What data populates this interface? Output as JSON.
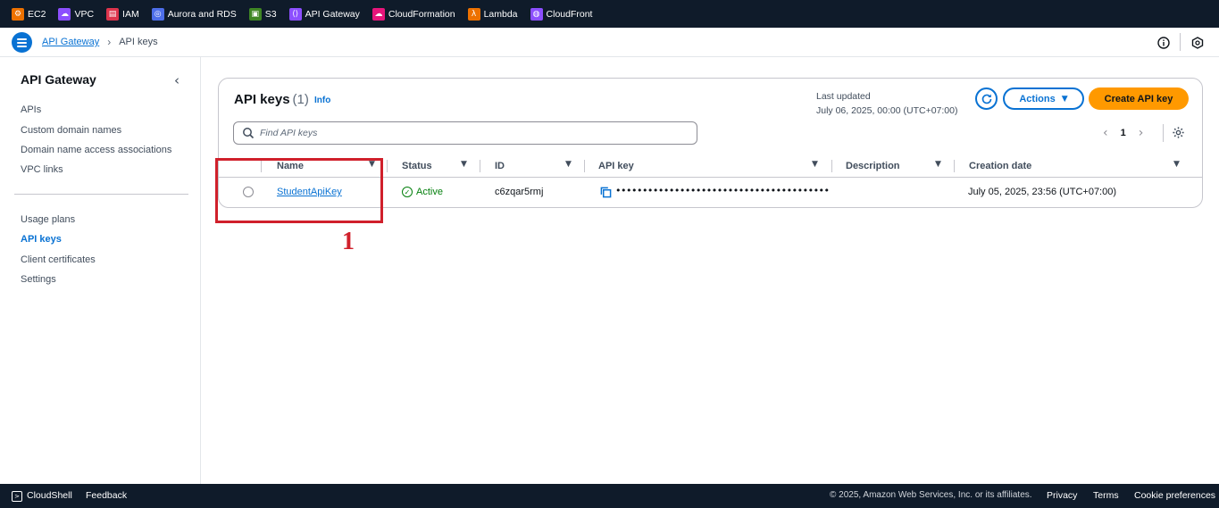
{
  "services": [
    {
      "label": "EC2",
      "icon": "ec2-icon",
      "color": "#ed7100",
      "glyph": "⚙"
    },
    {
      "label": "VPC",
      "icon": "vpc-icon",
      "color": "#8c4fff",
      "glyph": "☁"
    },
    {
      "label": "IAM",
      "icon": "iam-icon",
      "color": "#dd344c",
      "glyph": "▤"
    },
    {
      "label": "Aurora and RDS",
      "icon": "rds-icon",
      "color": "#4d6ee9",
      "glyph": "◎"
    },
    {
      "label": "S3",
      "icon": "s3-icon",
      "color": "#3f8624",
      "glyph": "▣"
    },
    {
      "label": "API Gateway",
      "icon": "api-gateway-icon",
      "color": "#8c4fff",
      "glyph": "⟨⟩"
    },
    {
      "label": "CloudFormation",
      "icon": "cloudformation-icon",
      "color": "#e7157b",
      "glyph": "☁"
    },
    {
      "label": "Lambda",
      "icon": "lambda-icon",
      "color": "#ed7100",
      "glyph": "λ"
    },
    {
      "label": "CloudFront",
      "icon": "cloudfront-icon",
      "color": "#8c4fff",
      "glyph": "◍"
    }
  ],
  "breadcrumb": {
    "parent": "API Gateway",
    "separator": "›",
    "current": "API keys"
  },
  "sidebar": {
    "title": "API Gateway",
    "close_glyph": "‹",
    "items": [
      {
        "label": "APIs"
      },
      {
        "label": "Custom domain names"
      },
      {
        "label": "Domain name access associations"
      },
      {
        "label": "VPC links"
      },
      {
        "label": "Usage plans"
      },
      {
        "label": "API keys",
        "active": true
      },
      {
        "label": "Client certificates"
      },
      {
        "label": "Settings"
      }
    ]
  },
  "panel": {
    "title": "API keys",
    "count": "(1)",
    "info": "Info",
    "last_updated_label": "Last updated",
    "last_updated_value": "July 06, 2025, 00:00 (UTC+07:00)",
    "actions_label": "Actions",
    "create_label": "Create API key",
    "search_placeholder": "Find API keys",
    "page": "1"
  },
  "table": {
    "columns": [
      "Name",
      "Status",
      "ID",
      "API key",
      "Description",
      "Creation date"
    ],
    "rows": [
      {
        "name": "StudentApiKey",
        "status": "Active",
        "id": "c6zqar5rmj",
        "api_key": "••••••••••••••••••••••••••••••••••••••••",
        "description": "",
        "creation_date": "July 05, 2025, 23:56 (UTC+07:00)"
      }
    ]
  },
  "annotation": {
    "label": "1",
    "color": "#d0202b"
  },
  "footer": {
    "cloudshell": "CloudShell",
    "feedback": "Feedback",
    "copyright": "© 2025, Amazon Web Services, Inc. or its affiliates.",
    "privacy": "Privacy",
    "terms": "Terms",
    "cookies": "Cookie preferences"
  }
}
